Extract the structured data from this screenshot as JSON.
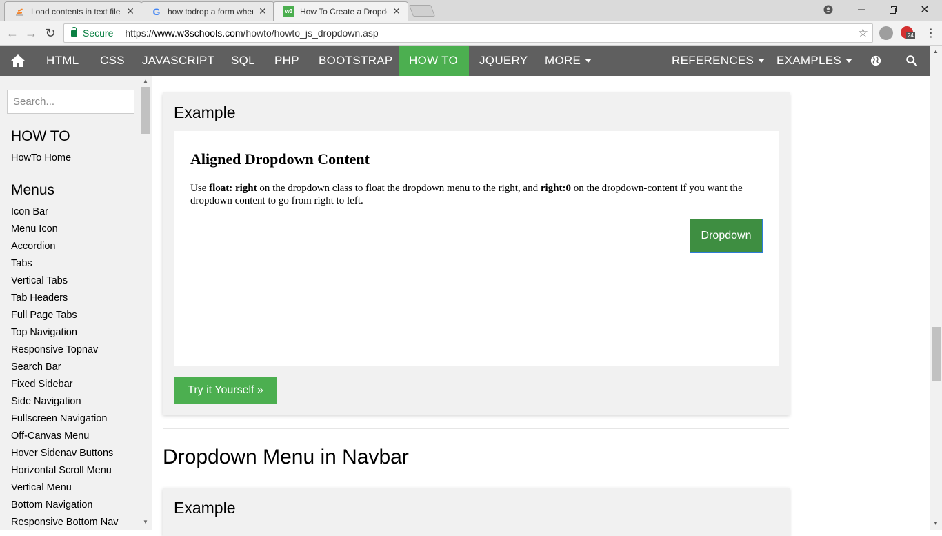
{
  "browser": {
    "tabs": [
      {
        "title": "Load contents in text file"
      },
      {
        "title": "how todrop a form when"
      },
      {
        "title": "How To Create a Dropdo"
      }
    ],
    "secure_label": "Secure",
    "url_scheme": "https://",
    "url_host": "www.w3schools.com",
    "url_path": "/howto/howto_js_dropdown.asp",
    "ext_badge": "24"
  },
  "navbar": {
    "items": [
      "HTML",
      "CSS",
      "JAVASCRIPT",
      "SQL",
      "PHP",
      "BOOTSTRAP",
      "HOW TO",
      "JQUERY",
      "MORE",
      "REFERENCES",
      "EXAMPLES"
    ],
    "active": "HOW TO"
  },
  "sidebar": {
    "search_placeholder": "Search...",
    "section1": "HOW TO",
    "home": "HowTo Home",
    "section2": "Menus",
    "links": [
      "Icon Bar",
      "Menu Icon",
      "Accordion",
      "Tabs",
      "Vertical Tabs",
      "Tab Headers",
      "Full Page Tabs",
      "Top Navigation",
      "Responsive Topnav",
      "Search Bar",
      "Fixed Sidebar",
      "Side Navigation",
      "Fullscreen Navigation",
      "Off-Canvas Menu",
      "Hover Sidenav Buttons",
      "Horizontal Scroll Menu",
      "Vertical Menu",
      "Bottom Navigation",
      "Responsive Bottom Nav"
    ]
  },
  "main": {
    "example_label": "Example",
    "demo_title": "Aligned Dropdown Content",
    "demo_text_1": "Use ",
    "demo_bold_1": "float: right",
    "demo_text_2": " on the dropdown class to float the dropdown menu to the right, and ",
    "demo_bold_2": "right:0",
    "demo_text_3": " on the dropdown-content if you want the dropdown content to go from right to left.",
    "dropdown_label": "Dropdown",
    "try_label": "Try it Yourself »",
    "section_heading": "Dropdown Menu in Navbar",
    "example2_label": "Example"
  }
}
